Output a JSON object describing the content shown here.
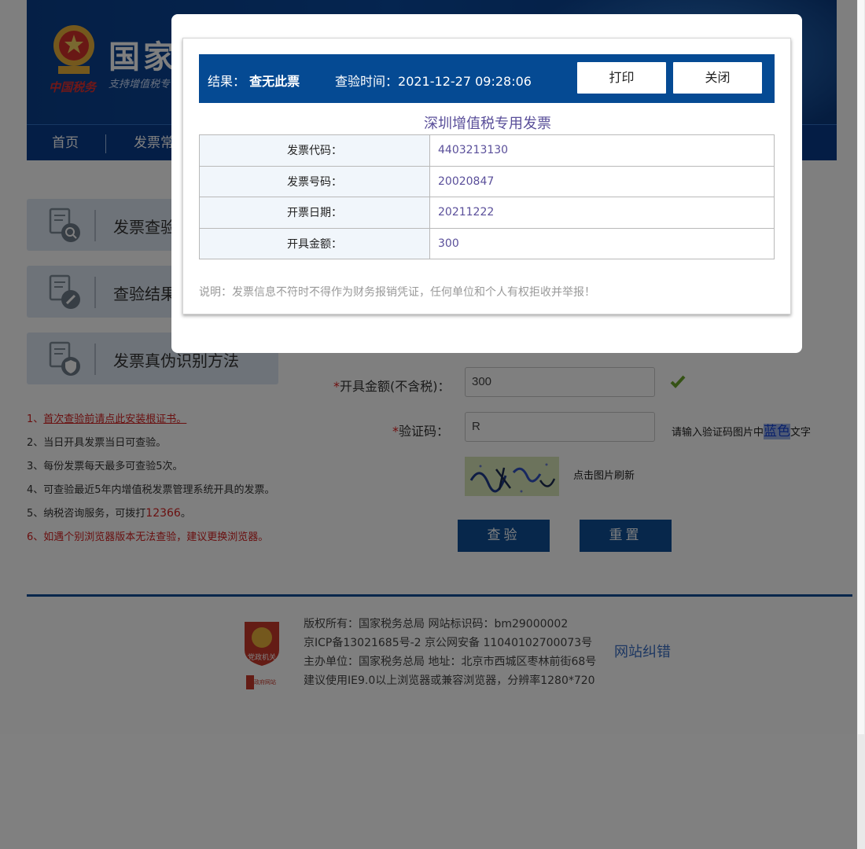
{
  "header": {
    "site_title": "国家",
    "slogan": "支持增值税专",
    "brand_sub": "中国税务",
    "nav": [
      "首页",
      "发票常"
    ]
  },
  "sidebar": {
    "cards": [
      {
        "label": "发票查验",
        "icon": "magnifier-document-icon"
      },
      {
        "label": "查验结果",
        "icon": "edit-document-icon"
      },
      {
        "label": "发票真伪识别方法",
        "icon": "shield-document-icon"
      }
    ]
  },
  "notes": {
    "n1_prefix": "1、",
    "n1_link": "首次查验前请点此安装根证书。",
    "n2": "2、当日开具发票当日可查验。",
    "n3": "3、每份发票每天最多可查验5次。",
    "n4": "4、可查验最近5年内增值税发票管理系统开具的发票。",
    "n5_prefix": "5、纳税咨询服务，可拨打",
    "n5_phone": "12366",
    "n5_suffix": "。",
    "n6": "6、如遇个别浏览器版本无法查验，建议更换浏览器。"
  },
  "form": {
    "amount_label": "开具金额(不含税)：",
    "amount_value": "300",
    "captcha_label": "验证码：",
    "captcha_value": "R",
    "required_mark": "*",
    "hint_prefix": "请输入验证码图片中",
    "hint_color": "蓝色",
    "hint_suffix": "文字",
    "captcha_refresh": "点击图片刷新",
    "submit_label": "查验",
    "reset_label": "重置"
  },
  "footer": {
    "line1": "版权所有：国家税务总局 网站标识码：bm29000002",
    "line2": "京ICP备13021685号-2 京公网安备 11040102700073号",
    "line3": "主办单位：国家税务总局 地址：北京市西城区枣林前街68号",
    "line4": "建议使用IE9.0以上浏览器或兼容浏览器，分辨率1280*720",
    "correction_link": "网站纠错",
    "badge_text": "党政机关",
    "badge2_text": "政府网站"
  },
  "modal": {
    "result_label": "结果：",
    "result_value": "查无此票",
    "time_label": "查验时间：",
    "time_value": "2021-12-27 09:28:06",
    "print_button": "打印",
    "close_button": "关闭",
    "invoice_title": "深圳增值税专用发票",
    "rows": [
      {
        "key": "发票代码：",
        "value": "4403213130"
      },
      {
        "key": "发票号码：",
        "value": "20020847"
      },
      {
        "key": "开票日期：",
        "value": "20211222"
      },
      {
        "key": "开具金额：",
        "value": "300"
      }
    ],
    "disclaimer": "说明：发票信息不符时不得作为财务报销凭证，任何单位和个人有权拒收并举报！"
  },
  "colors": {
    "primary": "#054a93",
    "overlay": "rgba(0,0,0,0.5)",
    "accent_text": "#5a4f9a",
    "warning_red": "#d42020"
  }
}
